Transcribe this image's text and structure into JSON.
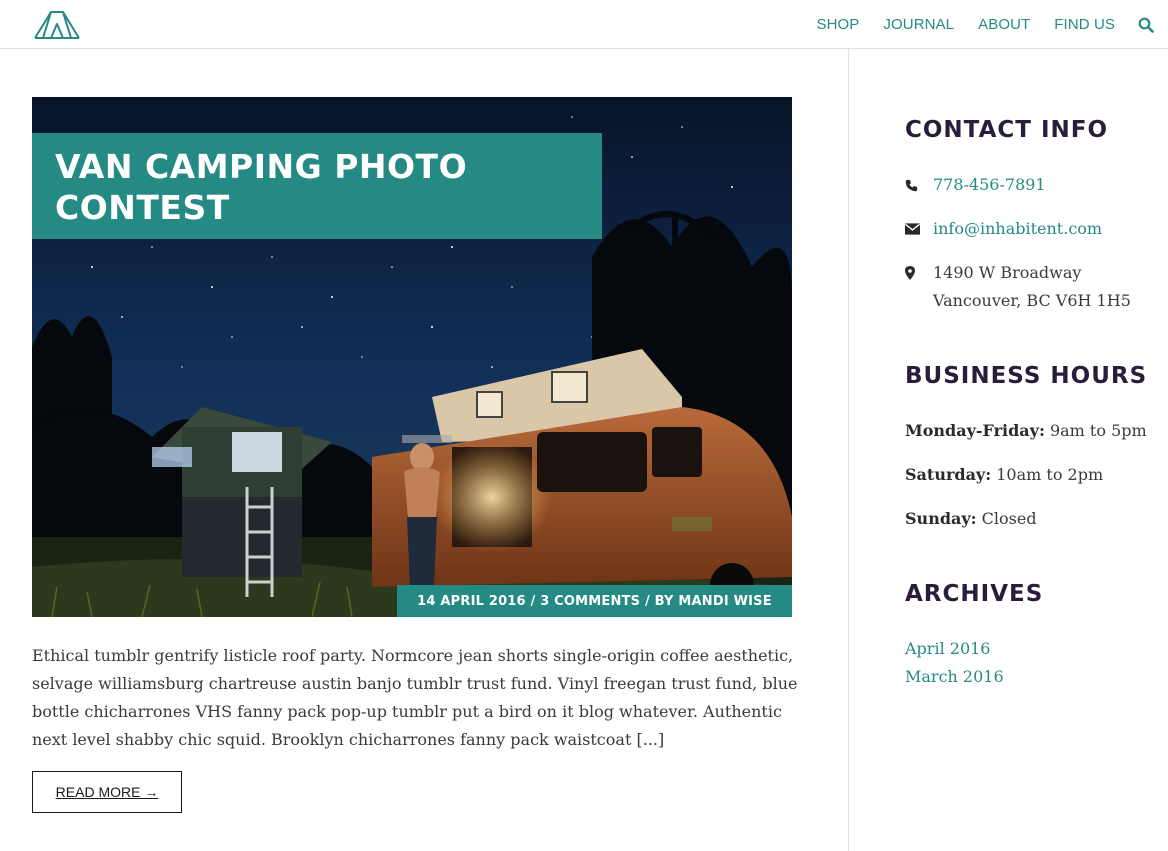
{
  "nav": {
    "items": [
      "SHOP",
      "JOURNAL",
      "ABOUT",
      "FIND US"
    ]
  },
  "post": {
    "title": "VAN CAMPING PHOTO CONTEST",
    "meta": "14 APRIL 2016 / 3 COMMENTS / BY MANDI WISE",
    "excerpt": "Ethical tumblr gentrify listicle roof party. Normcore jean shorts single-origin coffee aesthetic, selvage williamsburg chartreuse austin banjo tumblr trust fund. Vinyl freegan trust fund, blue bottle chicharrones VHS fanny pack pop-up tumblr put a bird on it blog whatever. Authentic next level shabby chic squid. Brooklyn chicharrones fanny pack waistcoat [...]",
    "read_more": "READ MORE →"
  },
  "sidebar": {
    "contact": {
      "title": "CONTACT INFO",
      "phone": "778-456-7891",
      "email": "info@inhabitent.com",
      "address_line1": "1490 W Broadway",
      "address_line2": "Vancouver, BC V6H 1H5"
    },
    "hours": {
      "title": "BUSINESS HOURS",
      "rows": [
        {
          "day": "Monday-Friday:",
          "time": "9am to 5pm"
        },
        {
          "day": "Saturday:",
          "time": "10am to 2pm"
        },
        {
          "day": "Sunday:",
          "time": "Closed"
        }
      ]
    },
    "archives": {
      "title": "ARCHIVES",
      "items": [
        "April 2016",
        "March 2016"
      ]
    }
  },
  "colors": {
    "accent": "#248a83",
    "heading": "#2a1d3a",
    "text": "#3a3a3a"
  }
}
